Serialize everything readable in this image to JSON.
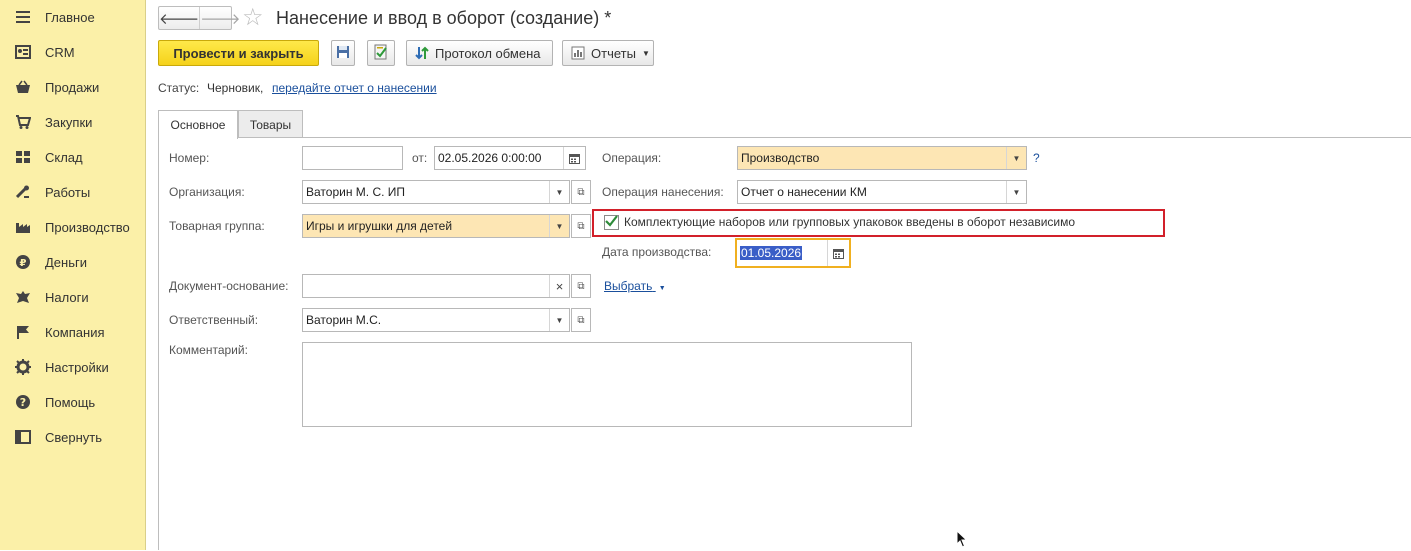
{
  "sidebar": {
    "items": [
      {
        "label": "Главное",
        "icon": "menu-icon"
      },
      {
        "label": "CRM",
        "icon": "crm-icon"
      },
      {
        "label": "Продажи",
        "icon": "basket-icon"
      },
      {
        "label": "Закупки",
        "icon": "cart-icon"
      },
      {
        "label": "Склад",
        "icon": "warehouse-icon"
      },
      {
        "label": "Работы",
        "icon": "tools-icon"
      },
      {
        "label": "Производство",
        "icon": "factory-icon"
      },
      {
        "label": "Деньги",
        "icon": "ruble-icon"
      },
      {
        "label": "Налоги",
        "icon": "emblem-icon"
      },
      {
        "label": "Компания",
        "icon": "flag-icon"
      },
      {
        "label": "Настройки",
        "icon": "gear-icon"
      },
      {
        "label": "Помощь",
        "icon": "help-icon"
      },
      {
        "label": "Свернуть",
        "icon": "collapse-icon"
      }
    ]
  },
  "header": {
    "title": "Нанесение и ввод в оборот (создание) *",
    "back": "🡐",
    "forward": "🡒",
    "star": "☆"
  },
  "toolbar": {
    "post_close": "Провести и закрыть",
    "exchange_log": "Протокол обмена",
    "reports": "Отчеты"
  },
  "status": {
    "label": "Статус:",
    "value": "Черновик,",
    "link": "передайте отчет о нанесении"
  },
  "tabs": [
    "Основное",
    "Товары"
  ],
  "form": {
    "number_label": "Номер:",
    "number_value": "",
    "date_label": "от:",
    "date_value": "02.05.2026  0:00:00",
    "org_label": "Организация:",
    "org_value": "Ваторин М. С. ИП",
    "group_label": "Товарная группа:",
    "group_value": "Игры и игрушки для детей",
    "basis_label": "Документ-основание:",
    "basis_value": "",
    "clear_symbol": "×",
    "resp_label": "Ответственный:",
    "resp_value": "Ваторин М.С.",
    "comment_label": "Комментарий:",
    "op_label": "Операция:",
    "op_value": "Производство",
    "help": "?",
    "op_apply_label": "Операция нанесения:",
    "op_apply_value": "Отчет о нанесении КМ",
    "checkbox_label": "Комплектующие наборов или групповых упаковок введены в оборот независимо",
    "checkbox_checked": true,
    "prod_date_label": "Дата производства:",
    "prod_date_value": "01.05.2026",
    "select_link": "Выбрать"
  },
  "colors": {
    "sidebar_bg": "#fbf0a8",
    "primary_button": "#f5d21a",
    "required_field": "#fde6b4",
    "highlight_border": "#d2202a",
    "focus_border": "#f0b020",
    "link": "#1a4f9c"
  }
}
